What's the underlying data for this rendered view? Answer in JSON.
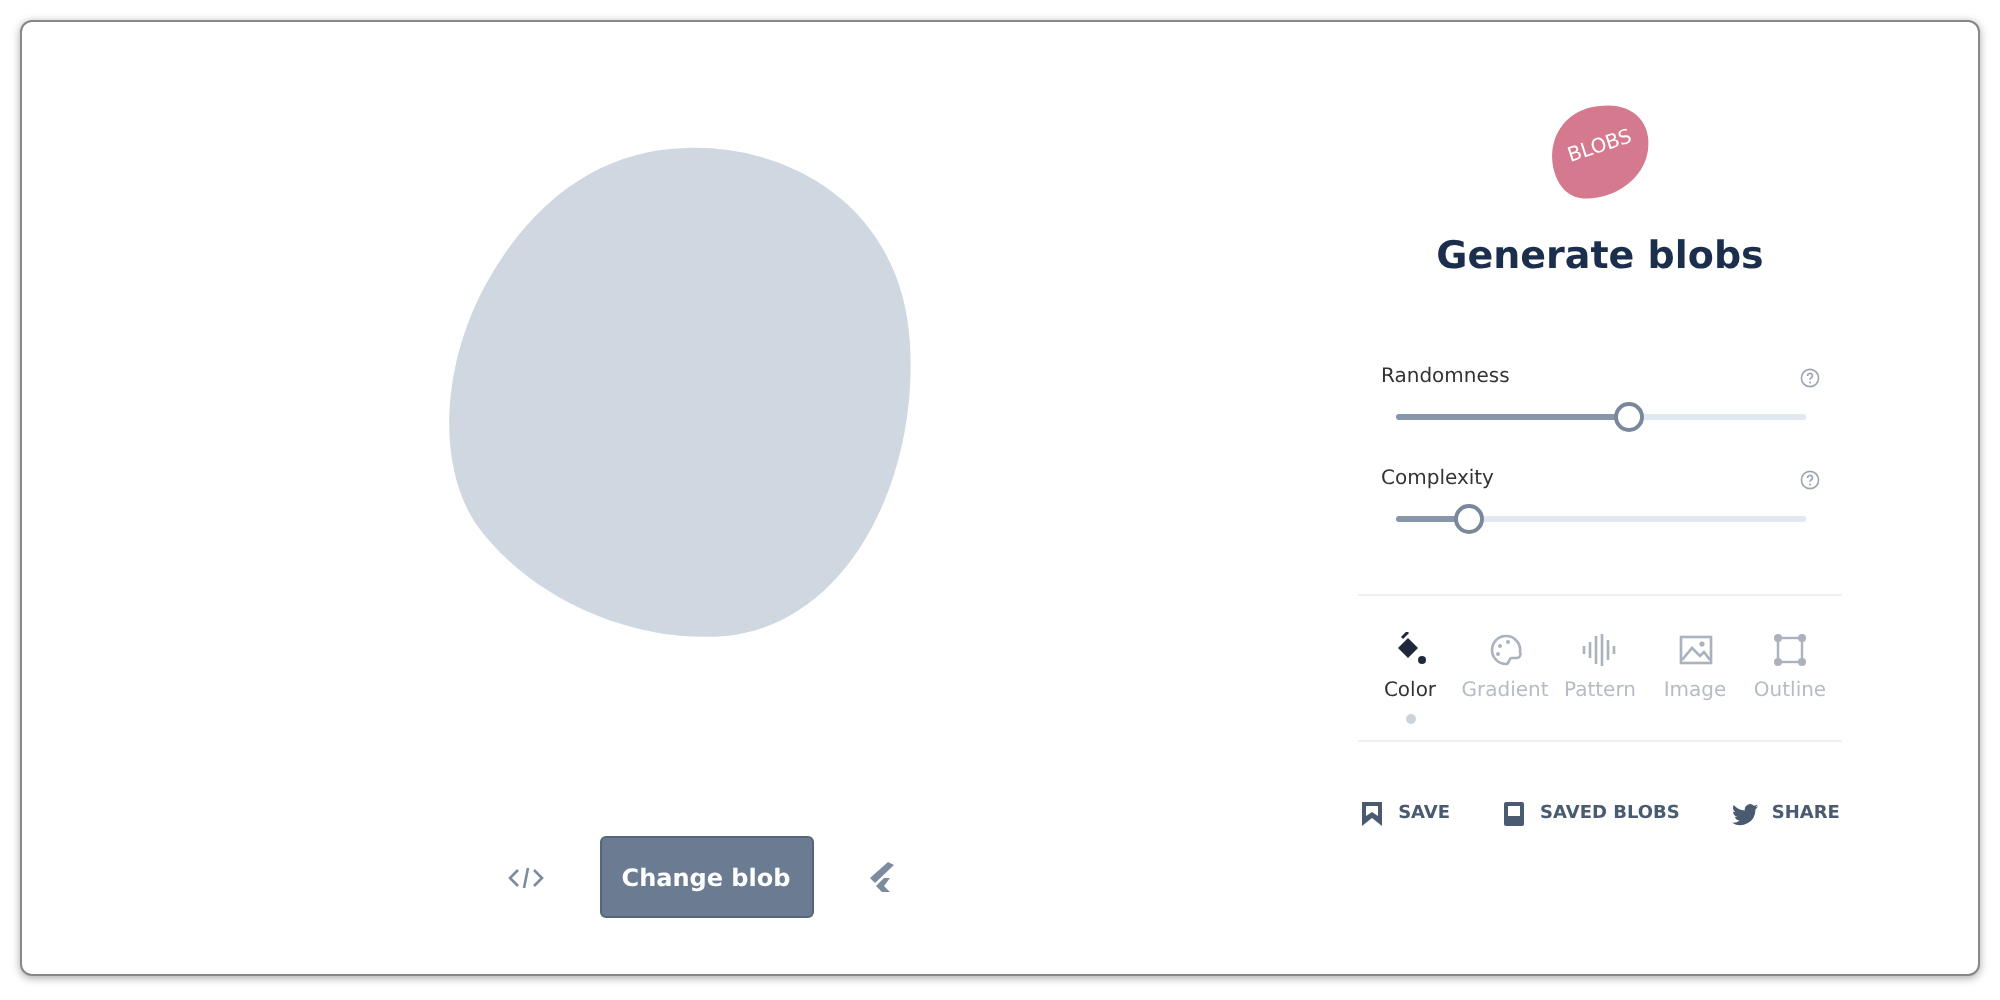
{
  "logo": {
    "label": "BLOBS"
  },
  "title": "Generate blobs",
  "sliders": [
    {
      "label": "Randomness",
      "level": 0.57
    },
    {
      "label": "Complexity",
      "level": 0.18
    }
  ],
  "tabs": [
    {
      "kind": "color",
      "label": "Color",
      "selected": true
    },
    {
      "kind": "gradient",
      "label": "Gradient",
      "selected": false
    },
    {
      "kind": "pattern",
      "label": "Pattern",
      "selected": false
    },
    {
      "kind": "image",
      "label": "Image",
      "selected": false
    },
    {
      "kind": "outline",
      "label": "Outline",
      "selected": false
    }
  ],
  "actions": [
    {
      "kind": "save",
      "label": "SAVE"
    },
    {
      "kind": "saved",
      "label": "SAVED BLOBS"
    },
    {
      "kind": "share",
      "label": "SHARE"
    }
  ],
  "main_button": "Change blob"
}
